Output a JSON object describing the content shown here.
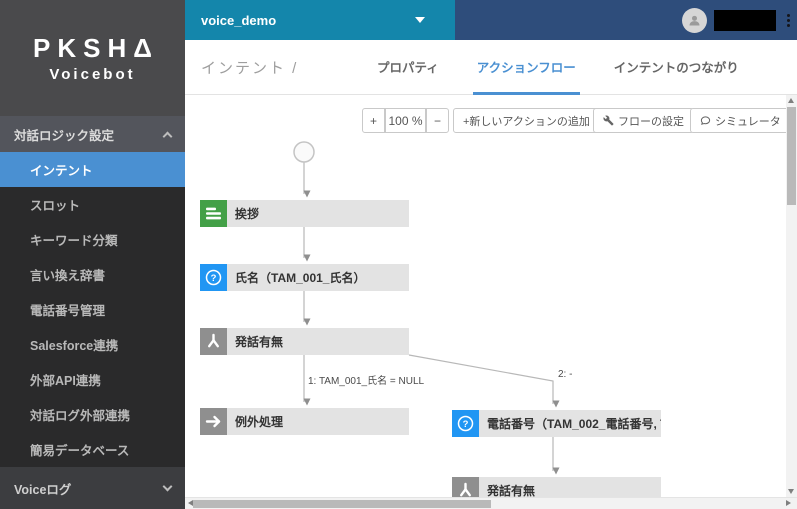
{
  "app": {
    "logo_line1": "PKSHΔ",
    "logo_line2": "Voicebot"
  },
  "topbar": {
    "project": "voice_demo"
  },
  "sidebar": {
    "sections": [
      {
        "label": "対話ロジック設定",
        "state": "expanded"
      },
      {
        "label": "Voiceログ",
        "state": "collapsed"
      }
    ],
    "items": [
      {
        "label": "インテント",
        "active": true
      },
      {
        "label": "スロット",
        "active": false
      },
      {
        "label": "キーワード分類",
        "active": false
      },
      {
        "label": "言い換え辞書",
        "active": false
      },
      {
        "label": "電話番号管理",
        "active": false
      },
      {
        "label": "Salesforce連携",
        "active": false
      },
      {
        "label": "外部API連携",
        "active": false
      },
      {
        "label": "対話ログ外部連携",
        "active": false
      },
      {
        "label": "簡易データベース",
        "active": false
      }
    ]
  },
  "header": {
    "breadcrumb": "インテント /",
    "tabs": [
      {
        "label": "プロパティ",
        "active": false
      },
      {
        "label": "アクションフロー",
        "active": true
      },
      {
        "label": "インテントのつながり",
        "active": false
      }
    ]
  },
  "canvas": {
    "zoom": {
      "plus": "+",
      "level": "100 %",
      "minus": "−"
    },
    "buttons": {
      "add_action": "+新しいアクションの追加",
      "flow_settings": "フローの設定",
      "simulator": "シミュレータ"
    },
    "nodes": [
      {
        "label": "挨拶",
        "icon": "text-lines-icon",
        "color": "#43a047"
      },
      {
        "label": "氏名（TAM_001_氏名）",
        "icon": "question-icon",
        "color": "#2196f3"
      },
      {
        "label": "発話有無",
        "icon": "branch-icon",
        "color": "#8f8f8f"
      },
      {
        "label": "例外処理",
        "icon": "arrow-right-icon",
        "color": "#8f8f8f"
      },
      {
        "label": "電話番号（TAM_002_電話番号, TA...",
        "icon": "question-icon",
        "color": "#2196f3"
      },
      {
        "label": "発話有無",
        "icon": "branch-icon",
        "color": "#8f8f8f"
      }
    ],
    "edge_labels": [
      {
        "text": "1: TAM_001_氏名 = NULL"
      },
      {
        "text": "2: -"
      }
    ]
  },
  "colors": {
    "accent_blue": "#4a90d2",
    "teal": "#1486ab",
    "navy": "#2e4d7b",
    "sidebar_dark": "#2a2a2b",
    "node_bg": "#e3e3e3",
    "green_icon": "#43a047",
    "blue_icon": "#2196f3",
    "gray_icon": "#8f8f8f"
  }
}
